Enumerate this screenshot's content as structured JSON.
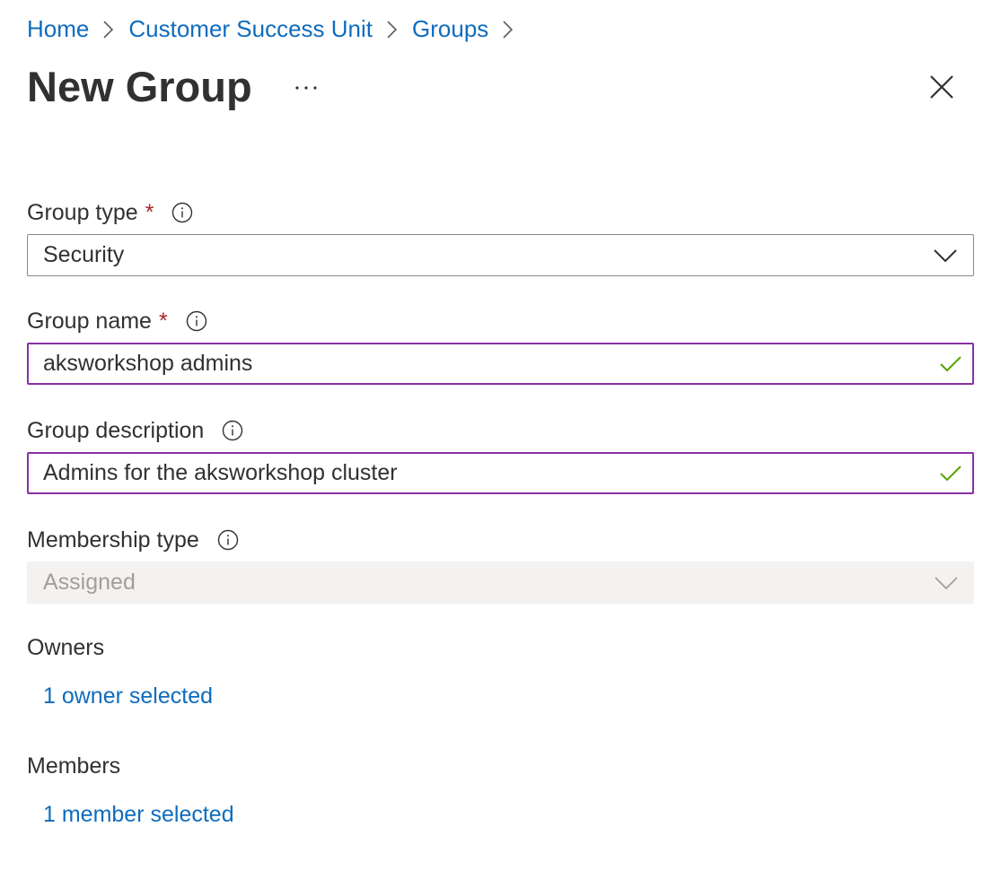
{
  "breadcrumb": {
    "items": [
      {
        "label": "Home"
      },
      {
        "label": "Customer Success Unit"
      },
      {
        "label": "Groups"
      }
    ]
  },
  "header": {
    "title": "New Group",
    "more_icon": "ellipsis-icon",
    "close_icon": "close-icon"
  },
  "form": {
    "group_type": {
      "label": "Group type",
      "required_mark": "*",
      "value": "Security"
    },
    "group_name": {
      "label": "Group name",
      "required_mark": "*",
      "value": "aksworkshop admins"
    },
    "group_description": {
      "label": "Group description",
      "value": "Admins for the aksworkshop cluster"
    },
    "membership_type": {
      "label": "Membership type",
      "value": "Assigned"
    },
    "owners": {
      "label": "Owners",
      "link": "1 owner selected"
    },
    "members": {
      "label": "Members",
      "link": "1 member selected"
    }
  },
  "colors": {
    "link": "#0f6cbd",
    "required": "#a4262c",
    "focus_border": "#8a2fa6",
    "valid_check": "#57a300",
    "disabled_bg": "#f3f2f1"
  }
}
